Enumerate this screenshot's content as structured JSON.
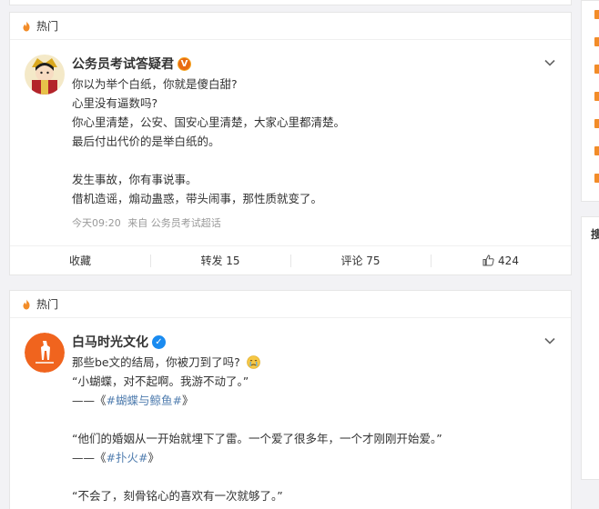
{
  "posts": [
    {
      "section_label": "热门",
      "author": "公务员考试答疑君",
      "badge": "V",
      "lines": [
        "你以为举个白纸，你就是傻白甜?",
        "心里没有逼数吗?",
        "你心里清楚，公安、国安心里清楚，大家心里都清楚。",
        "最后付出代价的是举白纸的。",
        "",
        "发生事故，你有事说事。",
        "借机造谣，煽动蛊惑，带头闹事，那性质就变了。"
      ],
      "time": "今天09:20",
      "source": "来自 公务员考试超话",
      "actions": {
        "favorite": "收藏",
        "repost": "转发 15",
        "comment": "评论 75",
        "like": "424"
      }
    },
    {
      "section_label": "热门",
      "author": "白马时光文化",
      "badge": "✓",
      "line1": "那些be文的结局，你被刀到了吗?",
      "quote1": "“小蝴蝶，对不起啊。我游不动了。”",
      "quote1_src_prefix": "——《",
      "quote1_src_tag": "#蝴蝶与鲸鱼#",
      "quote1_src_suffix": "》",
      "quote2": "“他们的婚姻从一开始就埋下了雷。一个爱了很多年，一个才刚刚开始爱。”",
      "quote2_src_prefix": "——《",
      "quote2_src_tag": "#扑火#",
      "quote2_src_suffix": "》",
      "quote3": "“不会了，刻骨铭心的喜欢有一次就够了。”"
    }
  ],
  "right_panel": {
    "tab_label": "搜"
  },
  "colors": {
    "link": "#507daf",
    "badge_gold": "#e86b12",
    "badge_blue": "#1a8bf0",
    "hot_flame": "#f28c28"
  },
  "icons": [
    "flame-icon",
    "verified-badge-icon",
    "chevron-down-icon",
    "thumbs-up-icon",
    "crying-emoji-icon"
  ]
}
